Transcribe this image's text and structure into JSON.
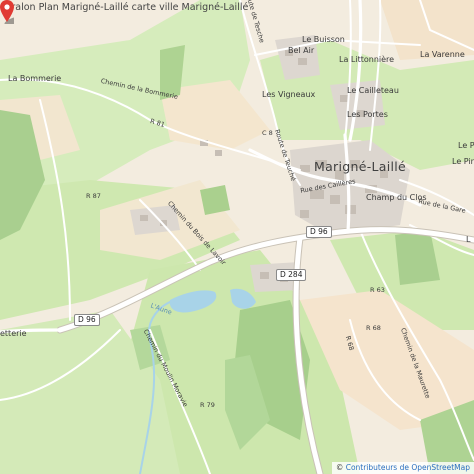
{
  "title": "Gralon Plan Marigné-Laillé carte ville Marigné-Laillé",
  "attribution": {
    "prefix": "© ",
    "link_text": "Contributeurs de OpenStreetMap"
  },
  "labels": {
    "bommerie": "La Bommerie",
    "chemin_bommerie": "Chemin de la Bommerie",
    "r81": "R 81",
    "r87": "R 87",
    "chemin_bois": "Chemin du Bois de Lavoir",
    "l_aune": "L'Aune",
    "etterie": "etterie",
    "chemin_moulin": "Chemin du Moulin Moravie",
    "r79": "R 79",
    "route_tesche": "Route de Tesche",
    "le_buisson": "Le Buisson",
    "bel_air": "Bel Air",
    "la_littonniere": "La Littonnière",
    "la_varenne": "La Varenne",
    "les_vigneaux": "Les Vigneaux",
    "le_cailleteau": "Le Cailleteau",
    "les_portes": "Les Portes",
    "c8": "C 8",
    "route_teuche": "Route de Teuché",
    "village": "Marigné-Laillé",
    "rue_cailleres": "Rue des Caillères",
    "champ_du_clos": "Champ du Clos",
    "rue_gare": "Rue de la Gare",
    "le_pin": "Le Pin",
    "le_pi": "Le Pi",
    "l_": "L",
    "r63": "R 63",
    "r68_a": "R 68",
    "r68_b": "R 68",
    "chemin_maurette": "Chemin de la Maurette"
  },
  "shields": {
    "d96_east": "D 96",
    "d284": "D 284",
    "d96_west": "D 96"
  },
  "marker": {
    "color": "#e03b33",
    "icon": "map-pin-icon"
  },
  "colors": {
    "background": "#f3ecdf",
    "meadow": "#cfe8b0",
    "forest": "#a7cf8c",
    "water": "#a8d3e8",
    "road_main": "#ffffff",
    "road_outline": "#c9c2b6",
    "built": "#d8d2cb"
  }
}
